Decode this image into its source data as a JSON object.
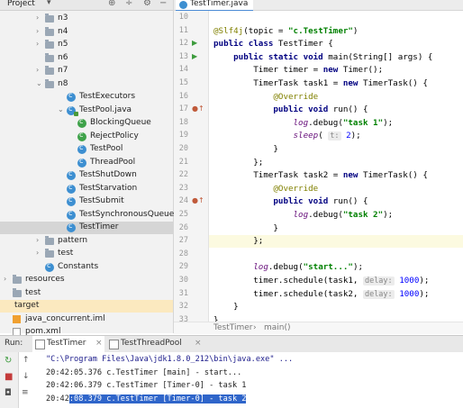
{
  "project": {
    "title": "Project",
    "dropdown": "▾",
    "tree": [
      {
        "label": "n3",
        "type": "folder",
        "arrow": "›",
        "indent": 3
      },
      {
        "label": "n4",
        "type": "folder",
        "arrow": "›",
        "indent": 3
      },
      {
        "label": "n5",
        "type": "folder",
        "arrow": "›",
        "indent": 3
      },
      {
        "label": "n6",
        "type": "folder",
        "arrow": "",
        "indent": 3
      },
      {
        "label": "n7",
        "type": "folder",
        "arrow": "›",
        "indent": 3
      },
      {
        "label": "n8",
        "type": "folder",
        "arrow": "⌄",
        "indent": 3
      },
      {
        "label": "TestExecutors",
        "type": "class",
        "arrow": "",
        "indent": 5
      },
      {
        "label": "TestPool.java",
        "type": "javafile",
        "arrow": "⌄",
        "indent": 5
      },
      {
        "label": "BlockingQueue",
        "type": "inner",
        "arrow": "",
        "indent": 6
      },
      {
        "label": "RejectPolicy",
        "type": "inner",
        "arrow": "",
        "indent": 6
      },
      {
        "label": "TestPool",
        "type": "class",
        "arrow": "",
        "indent": 6
      },
      {
        "label": "ThreadPool",
        "type": "class",
        "arrow": "",
        "indent": 6
      },
      {
        "label": "TestShutDown",
        "type": "class",
        "arrow": "",
        "indent": 5
      },
      {
        "label": "TestStarvation",
        "type": "class",
        "arrow": "",
        "indent": 5
      },
      {
        "label": "TestSubmit",
        "type": "class",
        "arrow": "",
        "indent": 5
      },
      {
        "label": "TestSynchronousQueue",
        "type": "class",
        "arrow": "",
        "indent": 5
      },
      {
        "label": "TestTimer",
        "type": "class",
        "arrow": "",
        "indent": 5,
        "selected": true
      },
      {
        "label": "pattern",
        "type": "folder",
        "arrow": "›",
        "indent": 3
      },
      {
        "label": "test",
        "type": "folder",
        "arrow": "›",
        "indent": 3
      },
      {
        "label": "Constants",
        "type": "class",
        "arrow": "",
        "indent": 3
      },
      {
        "label": "resources",
        "type": "folder",
        "arrow": "›",
        "indent": 0
      },
      {
        "label": "test",
        "type": "folder",
        "arrow": "",
        "indent": 0
      },
      {
        "label": "target",
        "type": "excluded",
        "arrow": "",
        "indent": 0
      },
      {
        "label": "java_concurrent.iml",
        "type": "iml",
        "arrow": "",
        "indent": 0
      },
      {
        "label": "pom.xml",
        "type": "file",
        "arrow": "",
        "indent": 0
      }
    ]
  },
  "editor": {
    "tab": "TestTimer.java",
    "lines": [
      {
        "n": "10",
        "tokens": []
      },
      {
        "n": "11",
        "tokens": [
          [
            "ann",
            "@Slf4j"
          ],
          [
            "",
            "(topic = "
          ],
          [
            "str",
            "\"c.TestTimer\""
          ],
          [
            "",
            ")"
          ]
        ]
      },
      {
        "n": "12",
        "mark": "run",
        "tokens": [
          [
            "kw",
            "public class "
          ],
          [
            "",
            "TestTimer {"
          ]
        ]
      },
      {
        "n": "13",
        "mark": "run",
        "tokens": [
          [
            "",
            "    "
          ],
          [
            "kw",
            "public static void "
          ],
          [
            "",
            "main(String[] args) {"
          ]
        ]
      },
      {
        "n": "14",
        "tokens": [
          [
            "",
            "        Timer timer = "
          ],
          [
            "kw",
            "new "
          ],
          [
            "",
            "Timer();"
          ]
        ]
      },
      {
        "n": "15",
        "tokens": [
          [
            "",
            "        TimerTask task1 = "
          ],
          [
            "kw",
            "new "
          ],
          [
            "",
            "TimerTask() {"
          ]
        ]
      },
      {
        "n": "16",
        "tokens": [
          [
            "",
            "            "
          ],
          [
            "ann",
            "@Override"
          ]
        ]
      },
      {
        "n": "17",
        "mark": "override",
        "tokens": [
          [
            "",
            "            "
          ],
          [
            "kw",
            "public void "
          ],
          [
            "",
            "run() {"
          ]
        ]
      },
      {
        "n": "18",
        "tokens": [
          [
            "",
            "                "
          ],
          [
            "ital",
            "log"
          ],
          [
            "",
            ".debug("
          ],
          [
            "str",
            "\"task 1\""
          ],
          [
            "",
            ");"
          ]
        ]
      },
      {
        "n": "19",
        "tokens": [
          [
            "",
            "                "
          ],
          [
            "ital",
            "sleep"
          ],
          [
            "",
            "( "
          ],
          [
            "hint",
            "t:"
          ],
          [
            "",
            " "
          ],
          [
            "num",
            "2"
          ],
          [
            "",
            ");"
          ]
        ]
      },
      {
        "n": "20",
        "tokens": [
          [
            "",
            "            }"
          ]
        ]
      },
      {
        "n": "21",
        "tokens": [
          [
            "",
            "        };"
          ]
        ]
      },
      {
        "n": "22",
        "tokens": [
          [
            "",
            "        TimerTask task2 = "
          ],
          [
            "kw",
            "new "
          ],
          [
            "",
            "TimerTask() {"
          ]
        ]
      },
      {
        "n": "23",
        "tokens": [
          [
            "",
            "            "
          ],
          [
            "ann",
            "@Override"
          ]
        ]
      },
      {
        "n": "24",
        "mark": "override",
        "tokens": [
          [
            "",
            "            "
          ],
          [
            "kw",
            "public void "
          ],
          [
            "",
            "run() {"
          ]
        ]
      },
      {
        "n": "25",
        "tokens": [
          [
            "",
            "                "
          ],
          [
            "ital",
            "log"
          ],
          [
            "",
            ".debug("
          ],
          [
            "str",
            "\"task 2\""
          ],
          [
            "",
            ");"
          ]
        ]
      },
      {
        "n": "26",
        "tokens": [
          [
            "",
            "            }"
          ]
        ]
      },
      {
        "n": "27",
        "current": true,
        "tokens": [
          [
            "",
            "        };"
          ]
        ]
      },
      {
        "n": "28",
        "tokens": []
      },
      {
        "n": "29",
        "tokens": [
          [
            "",
            "        "
          ],
          [
            "ital",
            "log"
          ],
          [
            "",
            ".debug("
          ],
          [
            "str",
            "\"start...\""
          ],
          [
            "",
            ");"
          ]
        ]
      },
      {
        "n": "30",
        "tokens": [
          [
            "",
            "        timer.schedule(task1, "
          ],
          [
            "hint",
            "delay:"
          ],
          [
            "",
            " "
          ],
          [
            "num",
            "1000"
          ],
          [
            "",
            ");"
          ]
        ]
      },
      {
        "n": "31",
        "tokens": [
          [
            "",
            "        timer.schedule(task2, "
          ],
          [
            "hint",
            "delay:"
          ],
          [
            "",
            " "
          ],
          [
            "num",
            "1000"
          ],
          [
            "",
            ");"
          ]
        ]
      },
      {
        "n": "32",
        "tokens": [
          [
            "",
            "    }"
          ]
        ]
      },
      {
        "n": "33",
        "tokens": [
          [
            "",
            "}"
          ]
        ]
      }
    ],
    "breadcrumb": [
      "TestTimer",
      "main()"
    ]
  },
  "run": {
    "label": "Run:",
    "tabs": [
      {
        "label": "TestTimer",
        "active": true
      },
      {
        "label": "TestThreadPool",
        "active": false
      }
    ],
    "console": [
      "\"C:\\Program Files\\Java\\jdk1.8.0_212\\bin\\java.exe\" ...",
      "20:42:05.376 c.TestTimer [main] - start...",
      "20:42:06.379 c.TestTimer [Timer-0] - task 1",
      "20:42:08.379 c.TestTimer [Timer-0] - task 2"
    ],
    "selected_prefix": "20:42",
    "selected_rest": ":08.379 c.TestTimer [Timer-0] - task 2"
  },
  "icons": {
    "settings": "gear-icon",
    "collapse": "collapse-icon",
    "target": "locate-icon"
  }
}
